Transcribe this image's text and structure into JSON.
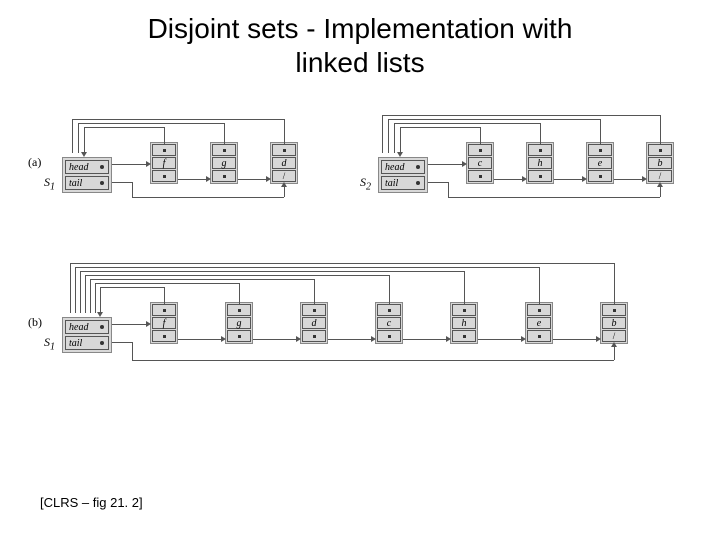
{
  "title_line1": "Disjoint sets - Implementation with",
  "title_line2": "linked lists",
  "citation": "[CLRS – fig 21. 2]",
  "labels": {
    "row_a": "(a)",
    "row_b": "(b)",
    "s1": "S",
    "s1_sub": "1",
    "s2": "S",
    "s2_sub": "2",
    "head": "head",
    "tail": "tail"
  },
  "sets": {
    "a_s1": {
      "nodes": [
        "f",
        "g",
        "d"
      ]
    },
    "a_s2": {
      "nodes": [
        "c",
        "h",
        "e",
        "b"
      ]
    },
    "b_s1": {
      "nodes": [
        "f",
        "g",
        "d",
        "c",
        "h",
        "e",
        "b"
      ]
    }
  }
}
